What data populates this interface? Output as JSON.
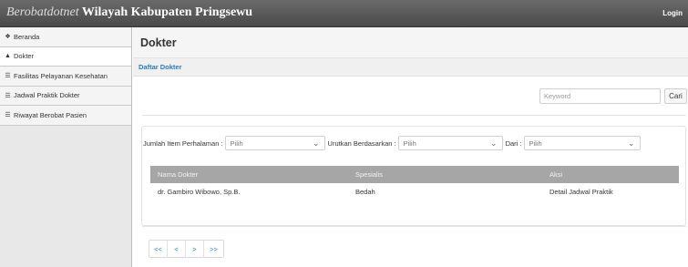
{
  "header": {
    "brand_italic": "Berobatdotnet",
    "brand_bold": " Wilayah Kabupaten Pringsewu",
    "login_label": "Login"
  },
  "sidebar": {
    "items": [
      {
        "label": "Beranda",
        "icon": "home-icon",
        "glyph": "❖"
      },
      {
        "label": "Dokter",
        "icon": "user-icon",
        "glyph": "▲"
      },
      {
        "label": "Fasilitas Pelayanan Kesehatan",
        "icon": "document-icon",
        "glyph": "☰"
      },
      {
        "label": "Jadwal Praktik Dokter",
        "icon": "document-icon",
        "glyph": "☰"
      },
      {
        "label": "Riwayat Berobat Pasien",
        "icon": "document-icon",
        "glyph": "☰"
      }
    ]
  },
  "main": {
    "title": "Dokter",
    "breadcrumb": "Daftar Dokter",
    "search": {
      "placeholder": "Keyword",
      "button_label": "Cari"
    },
    "filters": {
      "items_per_page_label": "Jumlah Item Perhalaman :",
      "items_per_page_value": "Pilih",
      "sort_by_label": "Urutkan Berdasarkan :",
      "sort_by_value": "Pilih",
      "order_label": "Dari :",
      "order_value": "Pilih"
    },
    "table": {
      "headers": [
        "Nama Dokter",
        "Spesialis",
        "Aksi"
      ],
      "rows": [
        {
          "name": "dr. Gambiro Wibowo, Sp.B.",
          "specialty": "Bedah",
          "action": "Detail Jadwal Praktik"
        }
      ]
    },
    "pagination": {
      "first": "<<",
      "prev": "<",
      "next": ">",
      "last": ">>"
    }
  },
  "colors": {
    "topbar": "#555555",
    "link": "#2a7ab8",
    "table_header": "#a6a6a6"
  }
}
